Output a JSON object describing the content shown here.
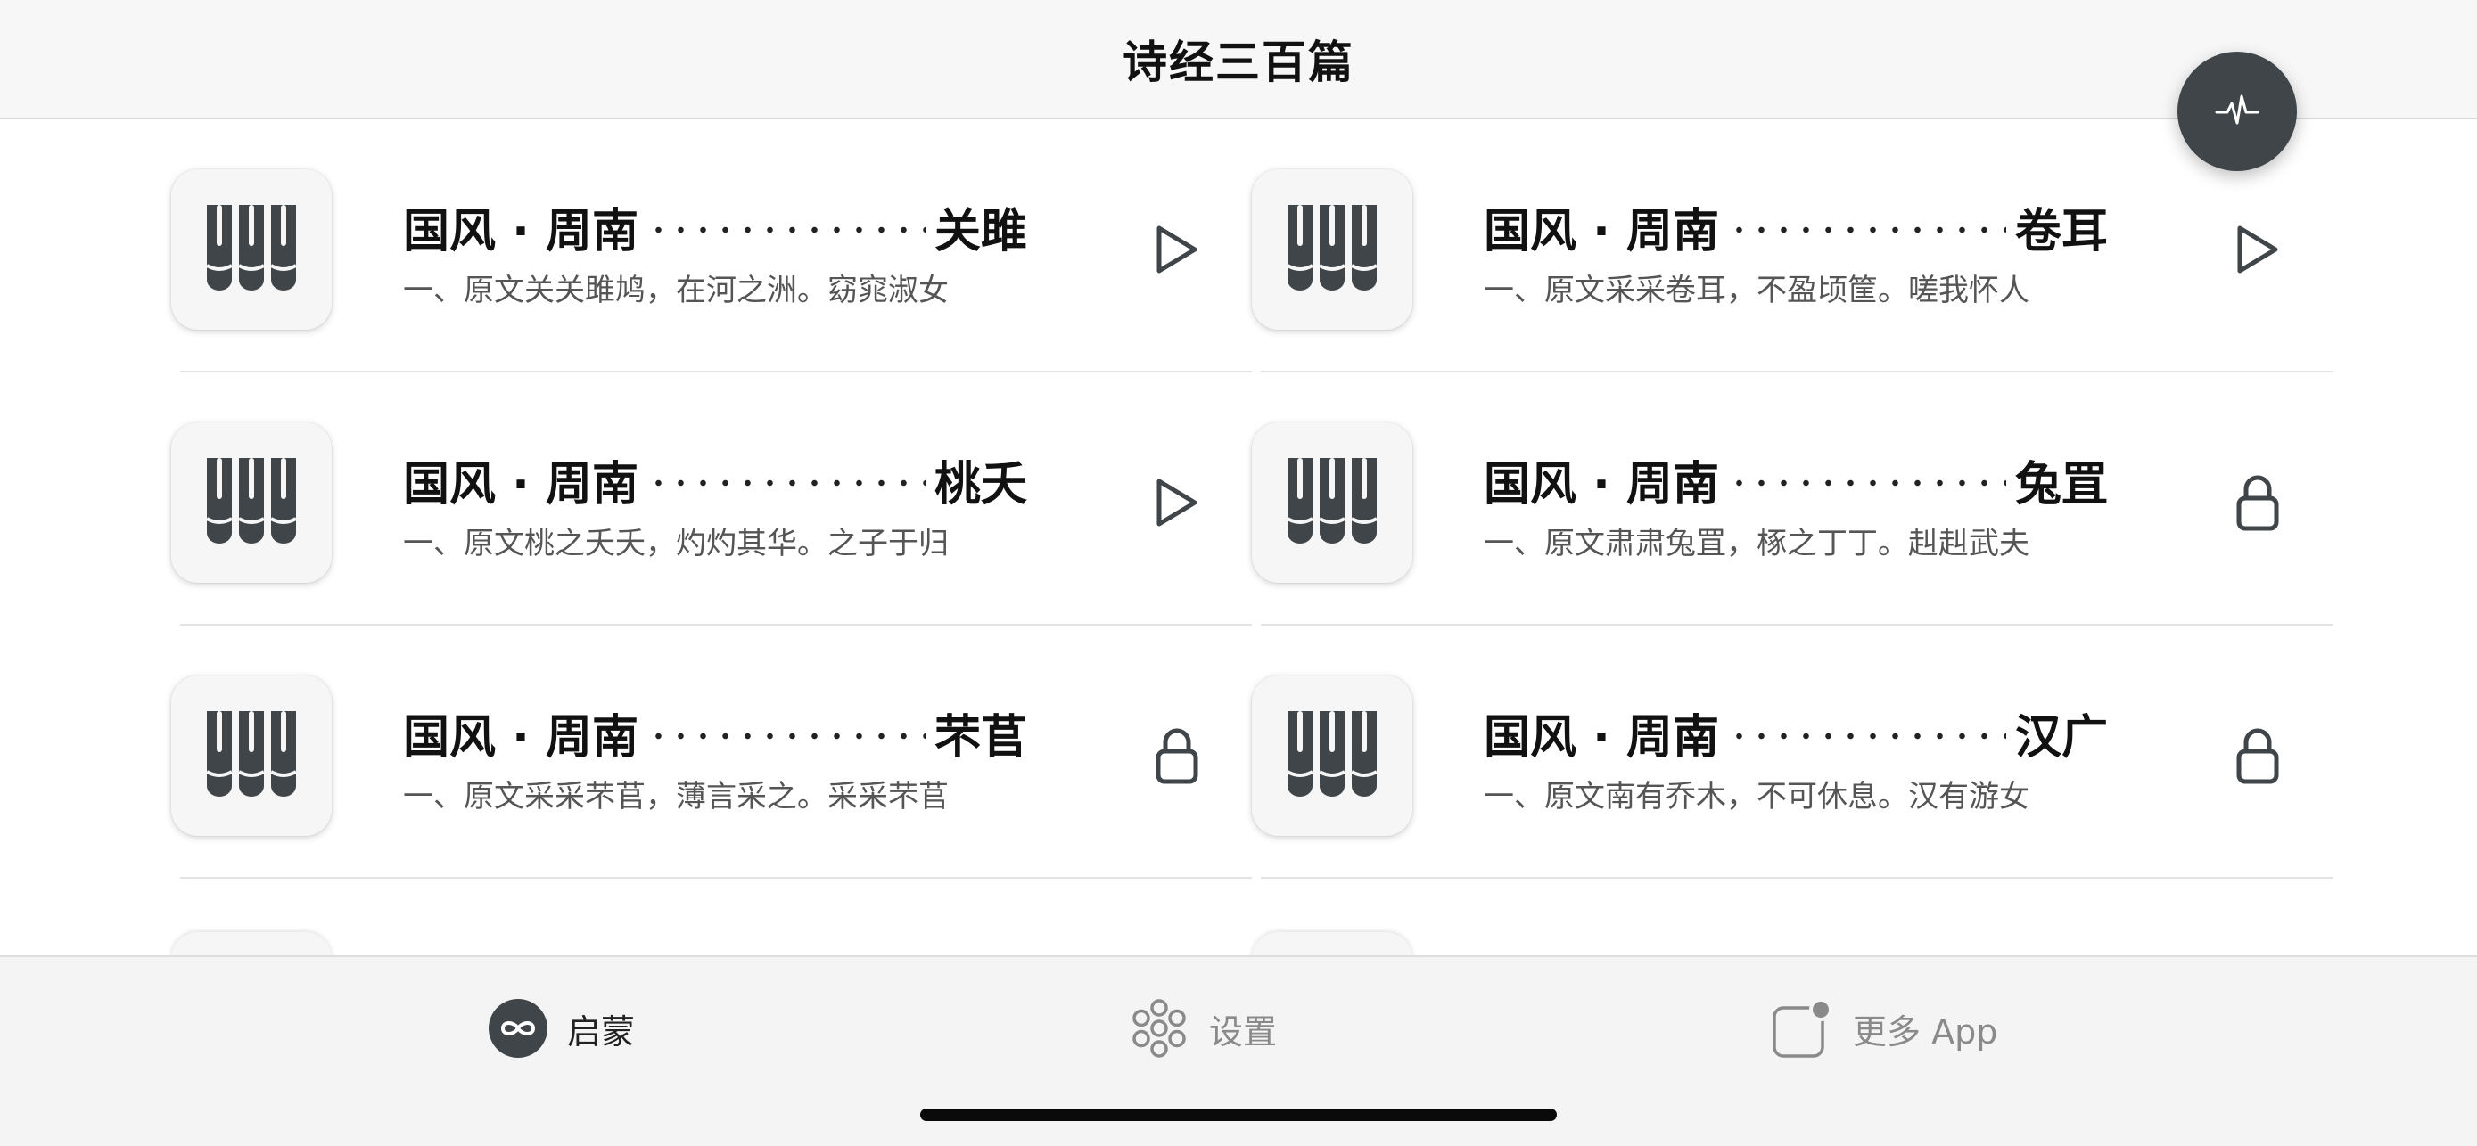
{
  "nav": {
    "title": "诗经三百篇"
  },
  "colors": {
    "icon_dark": "#3f4548",
    "accent_dark": "#3f4548"
  },
  "poems": [
    {
      "category": "国风 · 周南",
      "name": "关雎",
      "excerpt": "一、原文关关雎鸠，在河之洲。窈窕淑女",
      "action": "play-icon"
    },
    {
      "category": "国风 · 周南",
      "name": "卷耳",
      "excerpt": "一、原文采采卷耳，不盈顷筐。嗟我怀人",
      "action": "play-icon"
    },
    {
      "category": "国风 · 周南",
      "name": "桃夭",
      "excerpt": "一、原文桃之夭夭，灼灼其华。之子于归",
      "action": "play-icon"
    },
    {
      "category": "国风 · 周南",
      "name": "兔罝",
      "excerpt": "一、原文肃肃兔罝，椓之丁丁。赳赳武夫",
      "action": "lock-icon"
    },
    {
      "category": "国风 · 周南",
      "name": "芣苢",
      "excerpt": "一、原文采采芣苢，薄言采之。采采芣苢",
      "action": "lock-icon"
    },
    {
      "category": "国风 · 周南",
      "name": "汉广",
      "excerpt": "一、原文南有乔木，不可休息。汉有游女",
      "action": "lock-icon"
    }
  ],
  "tabs": [
    {
      "label": "启蒙",
      "icon": "infinity-icon",
      "active": true
    },
    {
      "label": "设置",
      "icon": "flower-icon",
      "active": false
    },
    {
      "label": "更多 App",
      "icon": "app-badge-icon",
      "active": false
    }
  ]
}
